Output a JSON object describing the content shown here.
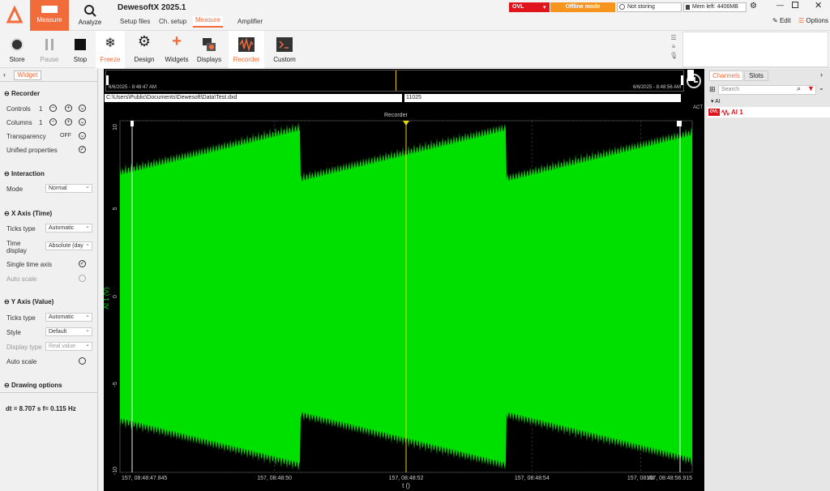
{
  "app": {
    "title": "DewesoftX 2025.1"
  },
  "modes": [
    {
      "label": "Measure"
    },
    {
      "label": "Analyze"
    }
  ],
  "tabs": [
    {
      "label": "Setup files"
    },
    {
      "label": "Ch. setup"
    },
    {
      "label": "Measure"
    },
    {
      "label": "Amplifier"
    }
  ],
  "status": {
    "ovl": "OVL",
    "offline": "Offline mode",
    "storing": "Not storing",
    "mem": "Mem left: 4406MB"
  },
  "window": {
    "edit": "Edit",
    "options": "Options"
  },
  "toolbar": [
    {
      "label": "Store"
    },
    {
      "label": "Pause"
    },
    {
      "label": "Stop"
    },
    {
      "label": "Freeze"
    },
    {
      "label": "Design"
    },
    {
      "label": "Widgets"
    },
    {
      "label": "Displays"
    },
    {
      "label": "Recorder"
    },
    {
      "label": "Custom"
    }
  ],
  "left": {
    "widget_tab": "Widget",
    "recorder": "Recorder",
    "controls": "Controls",
    "controls_val": "1",
    "columns": "Columns",
    "columns_val": "1",
    "transparency": "Transparency",
    "transparency_val": "OFF",
    "unified": "Unified properties",
    "interaction": "Interaction",
    "mode": "Mode",
    "mode_val": "Normal",
    "xaxis": "X Axis (Time)",
    "ticks": "Ticks type",
    "ticks_val": "Automatic",
    "time_display": "Time display",
    "time_display_val": "Absolute (day",
    "single_axis": "Single time axis",
    "auto_scale": "Auto scale",
    "yaxis": "Y Axis (Value)",
    "yticks": "Ticks type",
    "yticks_val": "Automatic",
    "style": "Style",
    "style_val": "Default",
    "display_type": "Display type",
    "display_type_val": "Real value",
    "yauto": "Auto scale",
    "drawing": "Drawing options",
    "dt": "dt = 8.707 s  f= 0.115 Hz"
  },
  "overview": {
    "start": "6/6/2025 - 8:48:47 AM",
    "end": "6/6/2025 - 8:48:56 AM"
  },
  "file": {
    "path": "C:\\Users\\Public\\Documents\\Dewesoft\\Data\\Test.dxd",
    "count": "11025"
  },
  "chart_data": {
    "type": "line",
    "title": "Recorder",
    "act": "ACT",
    "ylabel": "AI 1 (V)",
    "xlabel": "t ()",
    "ylim": [
      -10,
      10
    ],
    "yticks": [
      "10",
      "5",
      "0",
      "-5",
      "-10"
    ],
    "xticks": [
      "157, 08:48:47.845",
      "157, 08:48:50",
      "157, 08:48:52",
      "157, 08:48:54",
      "157, 08:48",
      "157, 08:48:56.915"
    ],
    "series": [
      {
        "name": "AI 1",
        "color": "#00e000",
        "shape": "sawtooth-modulated sine",
        "period_s": 2.6,
        "amp_min": 7.1,
        "amp_max": 10
      }
    ]
  },
  "right": {
    "tab_channels": "Channels",
    "tab_slots": "Slots",
    "search": "Search",
    "group": "AI",
    "channel": "AI 1",
    "ovl": "OVL"
  }
}
